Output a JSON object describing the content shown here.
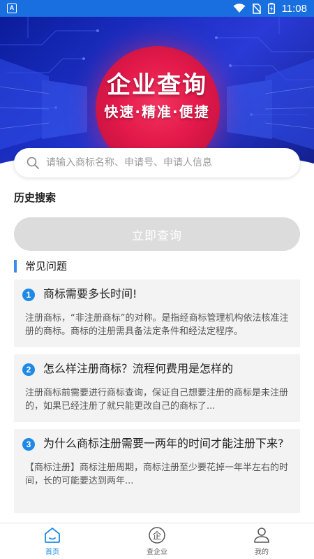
{
  "status_bar": {
    "time": "11:08",
    "app_icon_letter": "A"
  },
  "banner": {
    "title": "企业查询",
    "subtitle": "快速·精准·便捷"
  },
  "search": {
    "placeholder": "请输入商标名称、申请号、申请人信息",
    "value": ""
  },
  "history": {
    "title": "历史搜索"
  },
  "query_button": {
    "label": "立即查询"
  },
  "faq": {
    "title": "常见问题",
    "items": [
      {
        "number": "1",
        "question": "商标需要多长时间!",
        "answer": "注册商标，“非注册商标”的对称。是指经商标管理机构依法核准注册的商标。商标的注册需具备法定条件和经法定程序。"
      },
      {
        "number": "2",
        "question": "怎么样注册商标？流程何费用是怎样的",
        "answer": "注册商标前需要进行商标查询，保证自己想要注册的商标是未注册的，如果已经注册了就只能更改自己的商标了..."
      },
      {
        "number": "3",
        "question": "为什么商标注册需要一两年的时间才能注册下来?",
        "answer": "【商标注册】商标注册周期，商标注册至少要花掉一年半左右的时间，长的可能要达到两年..."
      }
    ]
  },
  "nav": {
    "items": [
      {
        "label": "首页",
        "icon": "home-icon",
        "active": true
      },
      {
        "label": "查企业",
        "icon": "enterprise-icon",
        "active": false
      },
      {
        "label": "我的",
        "icon": "user-icon",
        "active": false
      }
    ]
  },
  "colors": {
    "accent": "#1e8ae6",
    "status_bar": "#1a6fe0",
    "banner_circle": "#e3194a",
    "button_disabled": "#dcdcdc"
  }
}
